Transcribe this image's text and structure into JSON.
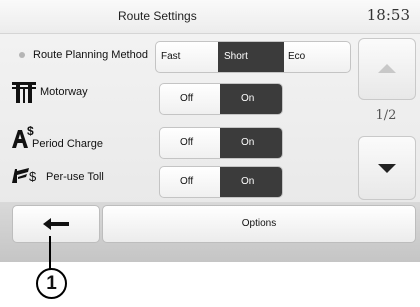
{
  "header": {
    "title": "Route Settings",
    "clock": "18:53"
  },
  "rows": [
    {
      "label": "Route Planning Method",
      "options": [
        "Fast",
        "Short",
        "Eco"
      ],
      "selected": "Short"
    },
    {
      "label": "Motorway",
      "options": [
        "Off",
        "On"
      ],
      "selected": "On"
    },
    {
      "label": "Period Charge",
      "options": [
        "Off",
        "On"
      ],
      "selected": "On"
    },
    {
      "label": "Per-use Toll",
      "options": [
        "Off",
        "On"
      ],
      "selected": "On"
    }
  ],
  "pager": {
    "text": "1/2"
  },
  "footer": {
    "options_label": "Options"
  },
  "callout": {
    "number": "1"
  }
}
